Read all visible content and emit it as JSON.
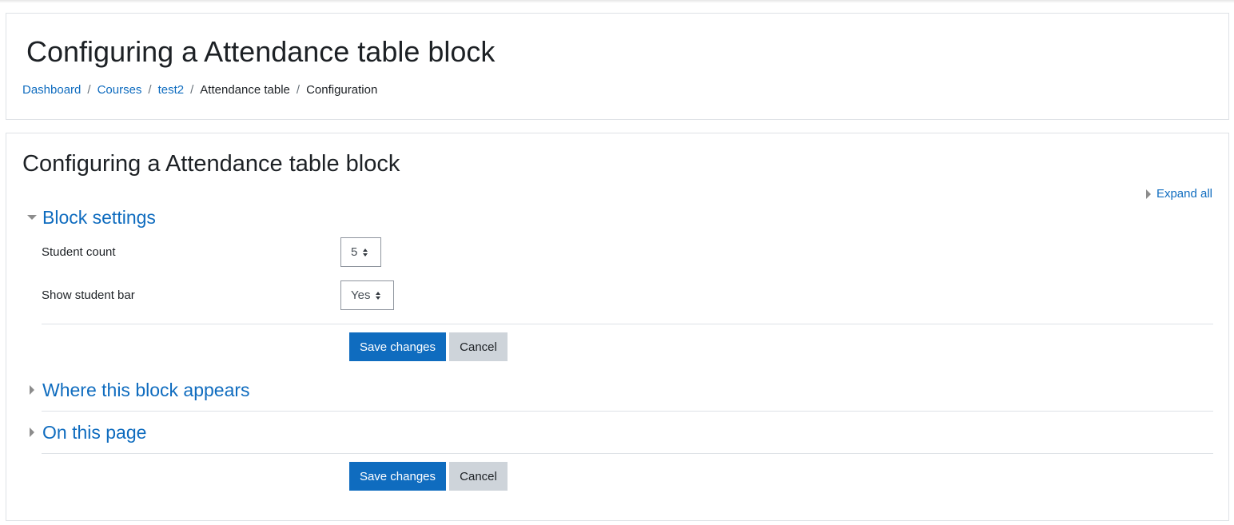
{
  "header": {
    "title": "Configuring a Attendance table block",
    "breadcrumb": [
      {
        "label": "Dashboard",
        "link": true
      },
      {
        "label": "Courses",
        "link": true
      },
      {
        "label": "test2",
        "link": true
      },
      {
        "label": "Attendance table",
        "link": false
      },
      {
        "label": "Configuration",
        "link": false
      }
    ],
    "separator": "/"
  },
  "main": {
    "title": "Configuring a Attendance table block",
    "expand_all": "Expand all",
    "sections": {
      "block_settings": {
        "label": "Block settings",
        "expanded": true,
        "fields": {
          "student_count": {
            "label": "Student count",
            "value": "5"
          },
          "show_student_bar": {
            "label": "Show student bar",
            "value": "Yes"
          }
        }
      },
      "where_block_appears": {
        "label": "Where this block appears",
        "expanded": false
      },
      "on_this_page": {
        "label": "On this page",
        "expanded": false
      }
    },
    "buttons": {
      "save": "Save changes",
      "cancel": "Cancel"
    }
  },
  "colors": {
    "link": "#0f6cbf",
    "primary_button": "#0f6cbf",
    "secondary_button": "#ced4da",
    "border": "#dee2e6",
    "text": "#1d2125"
  }
}
